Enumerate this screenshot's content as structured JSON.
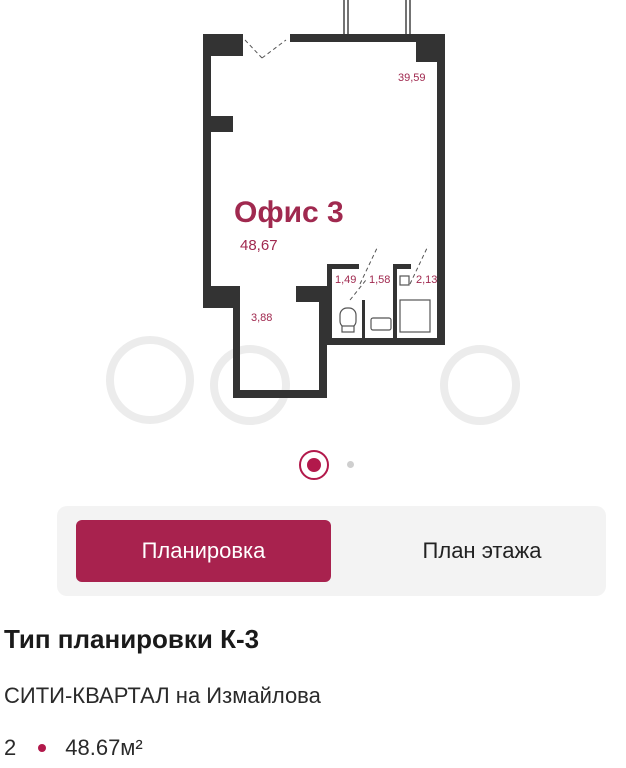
{
  "floorplan": {
    "office_title": "Офис 3",
    "area_main": "48,67",
    "area_balcony": "39,59",
    "area_corridor": "3,88",
    "area_wc": "1,49",
    "area_wash": "1,58",
    "area_shower": "2,13"
  },
  "gallery": {
    "current_slide": 1,
    "total_slides": 2
  },
  "tabs": {
    "layout_label": "Планировка",
    "floor_plan_label": "План этажа",
    "active": "layout_label"
  },
  "info": {
    "title": "Тип планировки К-3",
    "complex": "СИТИ-КВАРТАЛ на Измайлова",
    "rooms": "2",
    "area": "48.67м²"
  },
  "colors": {
    "accent": "#a8224e",
    "wall": "#333333"
  }
}
